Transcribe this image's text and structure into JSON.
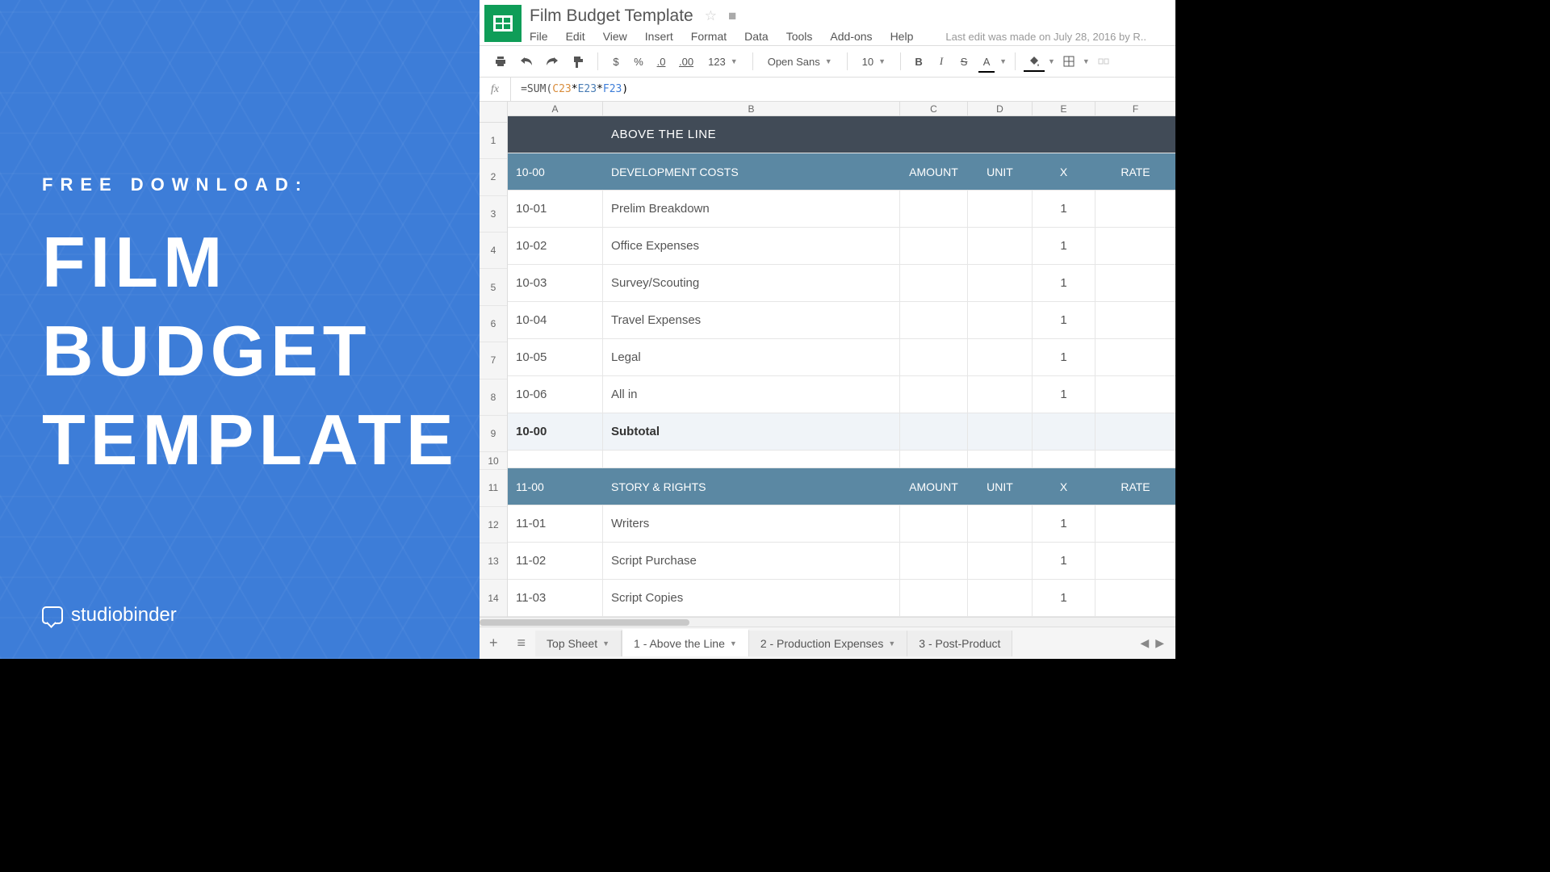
{
  "promo": {
    "subtitle": "FREE DOWNLOAD:",
    "title1": "FILM",
    "title2": "BUDGET",
    "title3": "TEMPLATE",
    "brand": "studiobinder"
  },
  "doc": {
    "title": "Film Budget Template",
    "lastEdit": "Last edit was made on July 28, 2016 by R.."
  },
  "menu": {
    "file": "File",
    "edit": "Edit",
    "view": "View",
    "insert": "Insert",
    "format": "Format",
    "data": "Data",
    "tools": "Tools",
    "addons": "Add-ons",
    "help": "Help"
  },
  "toolbar": {
    "dollar": "$",
    "percent": "%",
    "dec0": ".0",
    "dec00": ".00",
    "num": "123",
    "font": "Open Sans",
    "size": "10",
    "bold": "B",
    "italic": "I",
    "strike": "S",
    "textcolor": "A"
  },
  "formula": {
    "fx": "fx",
    "fn": "=SUM(",
    "ref1": "C23",
    "op1": "*",
    "ref2": "E23",
    "op2": "*",
    "ref3": "F23",
    "close": ")"
  },
  "cols": [
    "A",
    "B",
    "C",
    "D",
    "E",
    "F"
  ],
  "rows": [
    "1",
    "2",
    "3",
    "4",
    "5",
    "6",
    "7",
    "8",
    "9",
    "10",
    "11",
    "12",
    "13",
    "14"
  ],
  "grid": {
    "r1": {
      "b": "ABOVE THE LINE"
    },
    "r2": {
      "a": "10-00",
      "b": "DEVELOPMENT COSTS",
      "c": "AMOUNT",
      "d": "UNIT",
      "e": "X",
      "f": "RATE"
    },
    "r3": {
      "a": "10-01",
      "b": "Prelim Breakdown",
      "e": "1"
    },
    "r4": {
      "a": "10-02",
      "b": "Office Expenses",
      "e": "1"
    },
    "r5": {
      "a": "10-03",
      "b": "Survey/Scouting",
      "e": "1"
    },
    "r6": {
      "a": "10-04",
      "b": "Travel Expenses",
      "e": "1"
    },
    "r7": {
      "a": "10-05",
      "b": "Legal",
      "e": "1"
    },
    "r8": {
      "a": "10-06",
      "b": "All in",
      "e": "1"
    },
    "r9": {
      "a": "10-00",
      "b": "Subtotal"
    },
    "r11": {
      "a": "11-00",
      "b": "STORY & RIGHTS",
      "c": "AMOUNT",
      "d": "UNIT",
      "e": "X",
      "f": "RATE"
    },
    "r12": {
      "a": "11-01",
      "b": "Writers",
      "e": "1"
    },
    "r13": {
      "a": "11-02",
      "b": "Script Purchase",
      "e": "1"
    },
    "r14": {
      "a": "11-03",
      "b": "Script Copies",
      "e": "1"
    }
  },
  "tabs": {
    "add": "+",
    "t0": "Top Sheet",
    "t1": "1 - Above the Line",
    "t2": "2 - Production Expenses",
    "t3": "3 - Post-Product"
  }
}
